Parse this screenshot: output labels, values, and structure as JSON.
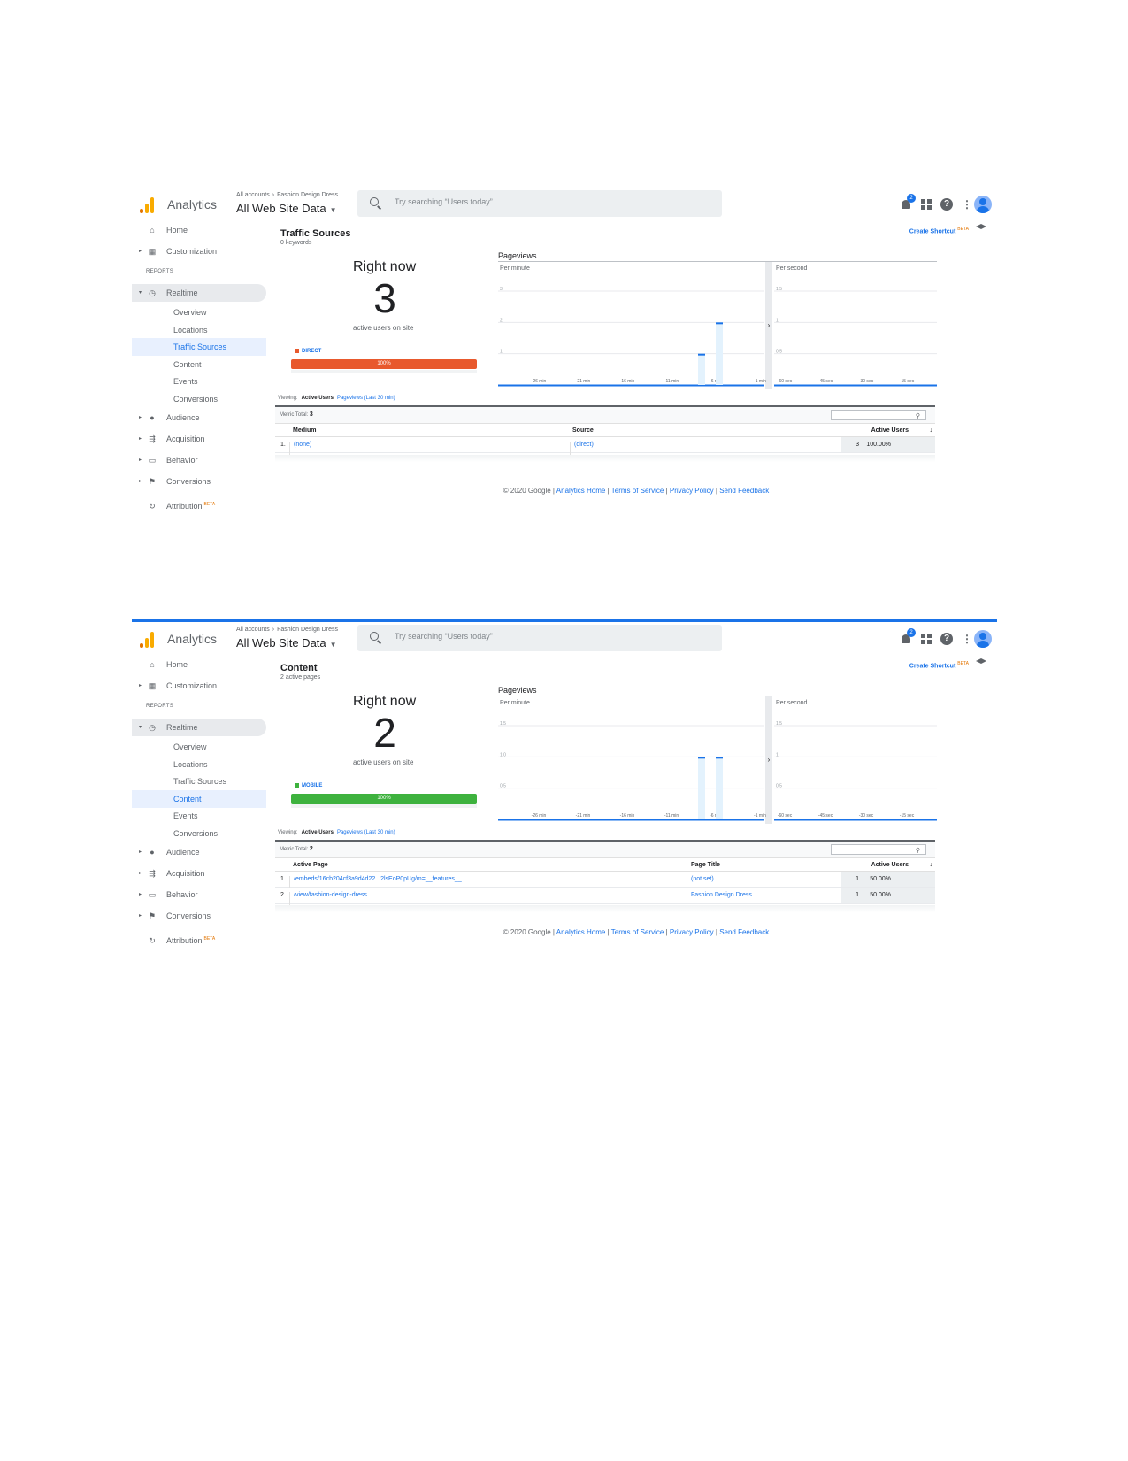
{
  "shots": [
    {
      "header": {
        "app_name": "Analytics",
        "crumb_accounts": "All accounts",
        "crumb_account": "Fashion Design Dress",
        "property": "All Web Site Data",
        "search_placeholder": "Try searching “Users today”",
        "notif_count": "2"
      },
      "sidebar": {
        "home": "Home",
        "customization": "Customization",
        "reports": "REPORTS",
        "realtime": "Realtime",
        "sub": [
          "Overview",
          "Locations",
          "Traffic Sources",
          "Content",
          "Events",
          "Conversions"
        ],
        "selected_sub": "Traffic Sources",
        "audience": "Audience",
        "acquisition": "Acquisition",
        "behavior": "Behavior",
        "conversions": "Conversions",
        "attribution": "Attribution",
        "beta": "BETA"
      },
      "main": {
        "title": "Traffic Sources",
        "subtitle": "0 keywords",
        "shortcut": "Create Shortcut",
        "beta": "BETA",
        "right_now": "Right now",
        "count": "3",
        "active_label": "active users on site",
        "source_label": "DIRECT",
        "source_color": "#e8592d",
        "bar_label": "100%",
        "pageviews": "Pageviews",
        "viewing_label": "Viewing:",
        "viewing_active": "Active Users",
        "viewing_pageviews": "Pageviews (Last 30 min)",
        "metric_label": "Metric Total:",
        "metric_total": "3",
        "columns": [
          "Medium",
          "Source",
          "Active Users"
        ],
        "rows": [
          {
            "idx": "1.",
            "c1": "(none)",
            "c2": "(direct)",
            "count": "3",
            "pct": "100.00%"
          }
        ]
      },
      "chart_data": {
        "type": "bar",
        "panels": [
          {
            "label": "Per minute",
            "y_ticks": [
              "1",
              "2",
              "3"
            ],
            "ylim": [
              0,
              3
            ],
            "x_ticks": [
              "-26 min",
              "-21 min",
              "-16 min",
              "-11 min",
              "-6 min",
              "-1 min"
            ],
            "bars": [
              {
                "x": -7,
                "y": 1
              },
              {
                "x": -5,
                "y": 2
              }
            ]
          },
          {
            "label": "Per second",
            "y_ticks": [
              "0.5",
              "1",
              "1.5"
            ],
            "ylim": [
              0,
              1.5
            ],
            "x_ticks": [
              "-60 sec",
              "-45 sec",
              "-30 sec",
              "-15 sec"
            ],
            "bars": []
          }
        ]
      },
      "footer": {
        "copy": "© 2020 Google",
        "links": [
          "Analytics Home",
          "Terms of Service",
          "Privacy Policy",
          "Send Feedback"
        ]
      }
    },
    {
      "header": {
        "app_name": "Analytics",
        "crumb_accounts": "All accounts",
        "crumb_account": "Fashion Design Dress",
        "property": "All Web Site Data",
        "search_placeholder": "Try searching “Users today”",
        "notif_count": "2"
      },
      "sidebar": {
        "home": "Home",
        "customization": "Customization",
        "reports": "REPORTS",
        "realtime": "Realtime",
        "sub": [
          "Overview",
          "Locations",
          "Traffic Sources",
          "Content",
          "Events",
          "Conversions"
        ],
        "selected_sub": "Content",
        "audience": "Audience",
        "acquisition": "Acquisition",
        "behavior": "Behavior",
        "conversions": "Conversions",
        "attribution": "Attribution",
        "beta": "BETA"
      },
      "main": {
        "title": "Content",
        "subtitle": "2 active pages",
        "shortcut": "Create Shortcut",
        "beta": "BETA",
        "right_now": "Right now",
        "count": "2",
        "active_label": "active users on site",
        "source_label": "MOBILE",
        "source_color": "#3eb23e",
        "bar_label": "100%",
        "pageviews": "Pageviews",
        "viewing_label": "Viewing:",
        "viewing_active": "Active Users",
        "viewing_pageviews": "Pageviews (Last 30 min)",
        "metric_label": "Metric Total:",
        "metric_total": "2",
        "columns": [
          "Active Page",
          "Page Title",
          "Active Users"
        ],
        "rows": [
          {
            "idx": "1.",
            "c1": "/embeds/16cb204cf3a9d4d22...2lsEoP0pUg/m=__features__",
            "c2": "(not set)",
            "count": "1",
            "pct": "50.00%"
          },
          {
            "idx": "2.",
            "c1": "/view/fashion-design-dress",
            "c2": "Fashion Design Dress",
            "count": "1",
            "pct": "50.00%"
          }
        ]
      },
      "chart_data": {
        "type": "bar",
        "panels": [
          {
            "label": "Per minute",
            "y_ticks": [
              "0.5",
              "1.0",
              "1.5"
            ],
            "ylim": [
              0,
              1.5
            ],
            "x_ticks": [
              "-26 min",
              "-21 min",
              "-16 min",
              "-11 min",
              "-6 min",
              "-1 min"
            ],
            "bars": [
              {
                "x": -7,
                "y": 1
              },
              {
                "x": -5,
                "y": 1
              }
            ]
          },
          {
            "label": "Per second",
            "y_ticks": [
              "0.5",
              "1",
              "1.5"
            ],
            "ylim": [
              0,
              1.5
            ],
            "x_ticks": [
              "-60 sec",
              "-45 sec",
              "-30 sec",
              "-15 sec"
            ],
            "bars": []
          }
        ]
      },
      "footer": {
        "copy": "© 2020 Google",
        "links": [
          "Analytics Home",
          "Terms of Service",
          "Privacy Policy",
          "Send Feedback"
        ]
      }
    }
  ],
  "colors": {
    "accent": "#1a73e8",
    "bar": "#1a73e8",
    "bar_bg": "#e3f2fd"
  }
}
